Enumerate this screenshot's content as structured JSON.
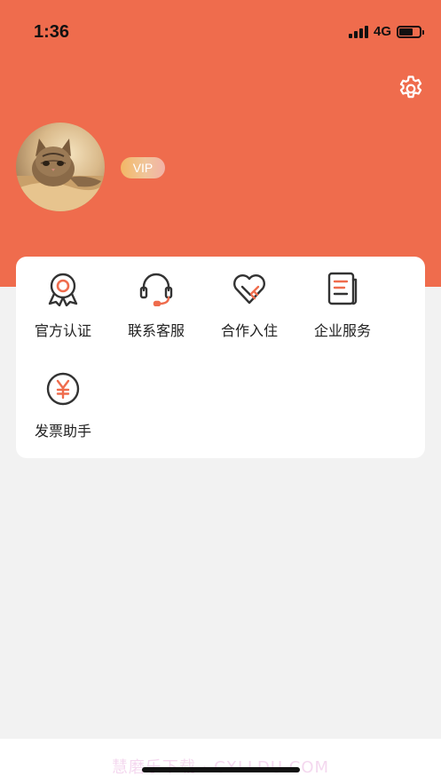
{
  "status_bar": {
    "time": "1:36",
    "network": "4G",
    "battery_level": 0.7
  },
  "profile": {
    "vip_label": "VIP",
    "avatar": "cat-photo"
  },
  "header": {
    "settings_icon": "gear-icon",
    "background_color": "#ef6c4d"
  },
  "menu": {
    "items": [
      {
        "label": "官方认证",
        "icon": "certificate-badge-icon"
      },
      {
        "label": "联系客服",
        "icon": "headset-icon"
      },
      {
        "label": "合作入住",
        "icon": "heart-handshake-icon"
      },
      {
        "label": "企业服务",
        "icon": "document-icon"
      },
      {
        "label": "发票助手",
        "icon": "yen-coin-icon"
      }
    ]
  },
  "footer": {
    "watermark": "慧磨乐下载 · CXLLDU.COM"
  },
  "colors": {
    "accent": "#ef6c4d",
    "icon_stroke": "#333333"
  }
}
